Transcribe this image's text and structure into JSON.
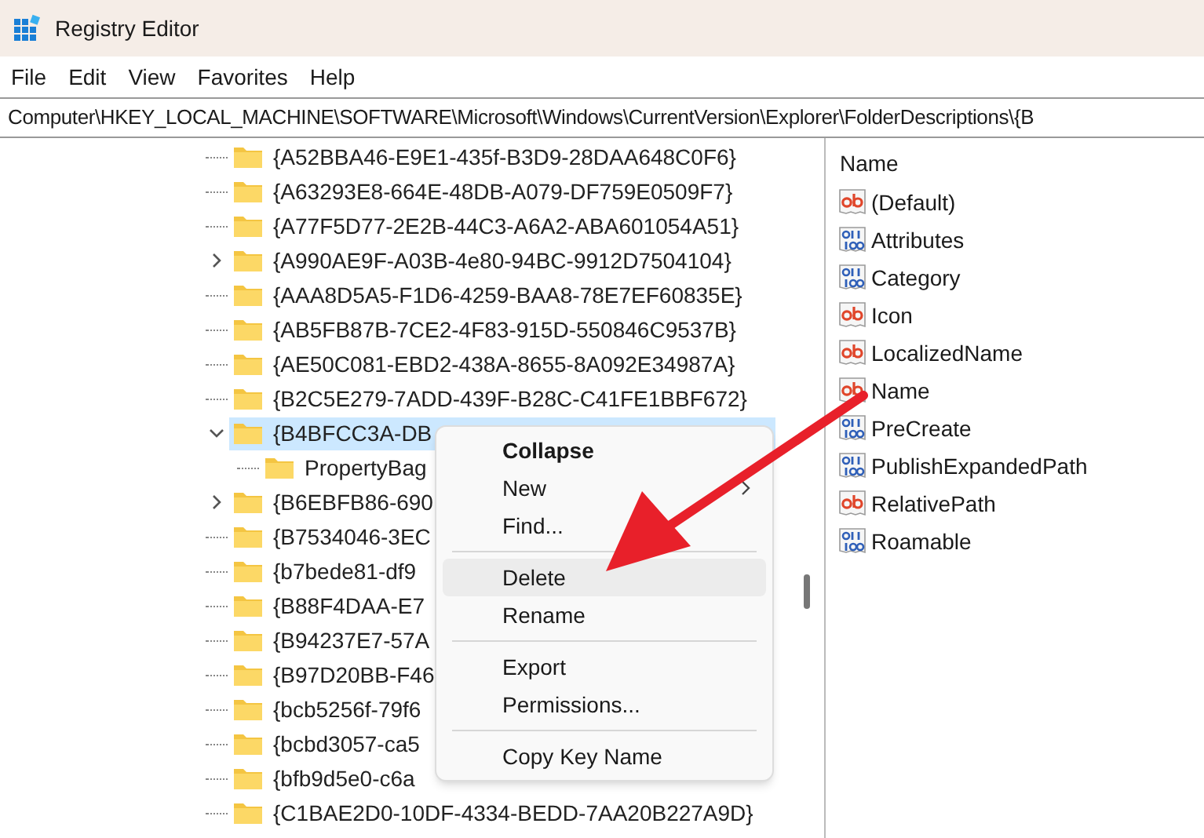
{
  "window": {
    "title": "Registry Editor"
  },
  "menu": [
    "File",
    "Edit",
    "View",
    "Favorites",
    "Help"
  ],
  "address": "Computer\\HKEY_LOCAL_MACHINE\\SOFTWARE\\Microsoft\\Windows\\CurrentVersion\\Explorer\\FolderDescriptions\\{B",
  "tree": [
    {
      "label": "{A52BBA46-E9E1-435f-B3D9-28DAA648C0F6}",
      "kind": "leaf",
      "selected": false
    },
    {
      "label": "{A63293E8-664E-48DB-A079-DF759E0509F7}",
      "kind": "leaf",
      "selected": false
    },
    {
      "label": "{A77F5D77-2E2B-44C3-A6A2-ABA601054A51}",
      "kind": "leaf",
      "selected": false
    },
    {
      "label": "{A990AE9F-A03B-4e80-94BC-9912D7504104}",
      "kind": "branch",
      "expanded": false,
      "selected": false
    },
    {
      "label": "{AAA8D5A5-F1D6-4259-BAA8-78E7EF60835E}",
      "kind": "leaf",
      "selected": false
    },
    {
      "label": "{AB5FB87B-7CE2-4F83-915D-550846C9537B}",
      "kind": "leaf",
      "selected": false
    },
    {
      "label": "{AE50C081-EBD2-438A-8655-8A092E34987A}",
      "kind": "leaf",
      "selected": false
    },
    {
      "label": "{B2C5E279-7ADD-439F-B28C-C41FE1BBF672}",
      "kind": "leaf",
      "selected": false
    },
    {
      "label": "{B4BFCC3A-DB",
      "kind": "branch",
      "expanded": true,
      "selected": true,
      "children": [
        {
          "label": "PropertyBag",
          "kind": "leaf",
          "selected": false
        }
      ]
    },
    {
      "label": "{B6EBFB86-690",
      "kind": "branch",
      "expanded": false,
      "selected": false
    },
    {
      "label": "{B7534046-3EC",
      "kind": "leaf",
      "selected": false
    },
    {
      "label": "{b7bede81-df9",
      "kind": "leaf",
      "selected": false
    },
    {
      "label": "{B88F4DAA-E7",
      "kind": "leaf",
      "selected": false
    },
    {
      "label": "{B94237E7-57A",
      "kind": "leaf",
      "selected": false
    },
    {
      "label": "{B97D20BB-F46",
      "kind": "leaf",
      "selected": false
    },
    {
      "label": "{bcb5256f-79f6",
      "kind": "leaf",
      "selected": false
    },
    {
      "label": "{bcbd3057-ca5",
      "kind": "leaf",
      "selected": false
    },
    {
      "label": "{bfb9d5e0-c6a",
      "kind": "leaf",
      "selected": false
    },
    {
      "label": "{C1BAE2D0-10DF-4334-BEDD-7AA20B227A9D}",
      "kind": "leaf",
      "selected": false
    }
  ],
  "values": {
    "column": "Name",
    "items": [
      {
        "name": "(Default)",
        "kind": "string"
      },
      {
        "name": "Attributes",
        "kind": "binary"
      },
      {
        "name": "Category",
        "kind": "binary"
      },
      {
        "name": "Icon",
        "kind": "string"
      },
      {
        "name": "LocalizedName",
        "kind": "string"
      },
      {
        "name": "Name",
        "kind": "string"
      },
      {
        "name": "PreCreate",
        "kind": "binary"
      },
      {
        "name": "PublishExpandedPath",
        "kind": "binary"
      },
      {
        "name": "RelativePath",
        "kind": "string"
      },
      {
        "name": "Roamable",
        "kind": "binary"
      }
    ]
  },
  "context_menu": [
    {
      "label": "Collapse",
      "kind": "item",
      "bold": true,
      "selected": false
    },
    {
      "label": "New",
      "kind": "submenu",
      "bold": false,
      "selected": false
    },
    {
      "label": "Find...",
      "kind": "item",
      "bold": false,
      "selected": false
    },
    {
      "kind": "separator"
    },
    {
      "label": "Delete",
      "kind": "item",
      "bold": false,
      "selected": true
    },
    {
      "label": "Rename",
      "kind": "item",
      "bold": false,
      "selected": false
    },
    {
      "kind": "separator"
    },
    {
      "label": "Export",
      "kind": "item",
      "bold": false,
      "selected": false
    },
    {
      "label": "Permissions...",
      "kind": "item",
      "bold": false,
      "selected": false
    },
    {
      "kind": "separator"
    },
    {
      "label": "Copy Key Name",
      "kind": "item",
      "bold": false,
      "selected": false
    }
  ]
}
